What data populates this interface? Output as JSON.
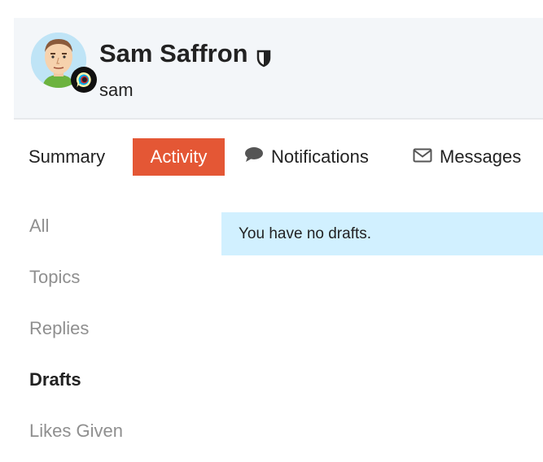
{
  "profile": {
    "full_name": "Sam Saffron",
    "username": "sam",
    "role_icon": "shield-icon",
    "flair_icon": "discourse-logo-icon"
  },
  "tabs": [
    {
      "label": "Summary",
      "icon": null,
      "active": false
    },
    {
      "label": "Activity",
      "icon": null,
      "active": true
    },
    {
      "label": "Notifications",
      "icon": "comment-icon",
      "active": false
    },
    {
      "label": "Messages",
      "icon": "envelope-icon",
      "active": false
    }
  ],
  "activity_nav": [
    {
      "label": "All",
      "active": false
    },
    {
      "label": "Topics",
      "active": false
    },
    {
      "label": "Replies",
      "active": false
    },
    {
      "label": "Drafts",
      "active": true
    },
    {
      "label": "Likes Given",
      "active": false
    }
  ],
  "main": {
    "empty_message": "You have no drafts."
  },
  "colors": {
    "accent": "#e45735",
    "header_bg": "#f3f6f9",
    "alert_bg": "#d1f0ff",
    "muted_text": "#8f8f8f"
  }
}
